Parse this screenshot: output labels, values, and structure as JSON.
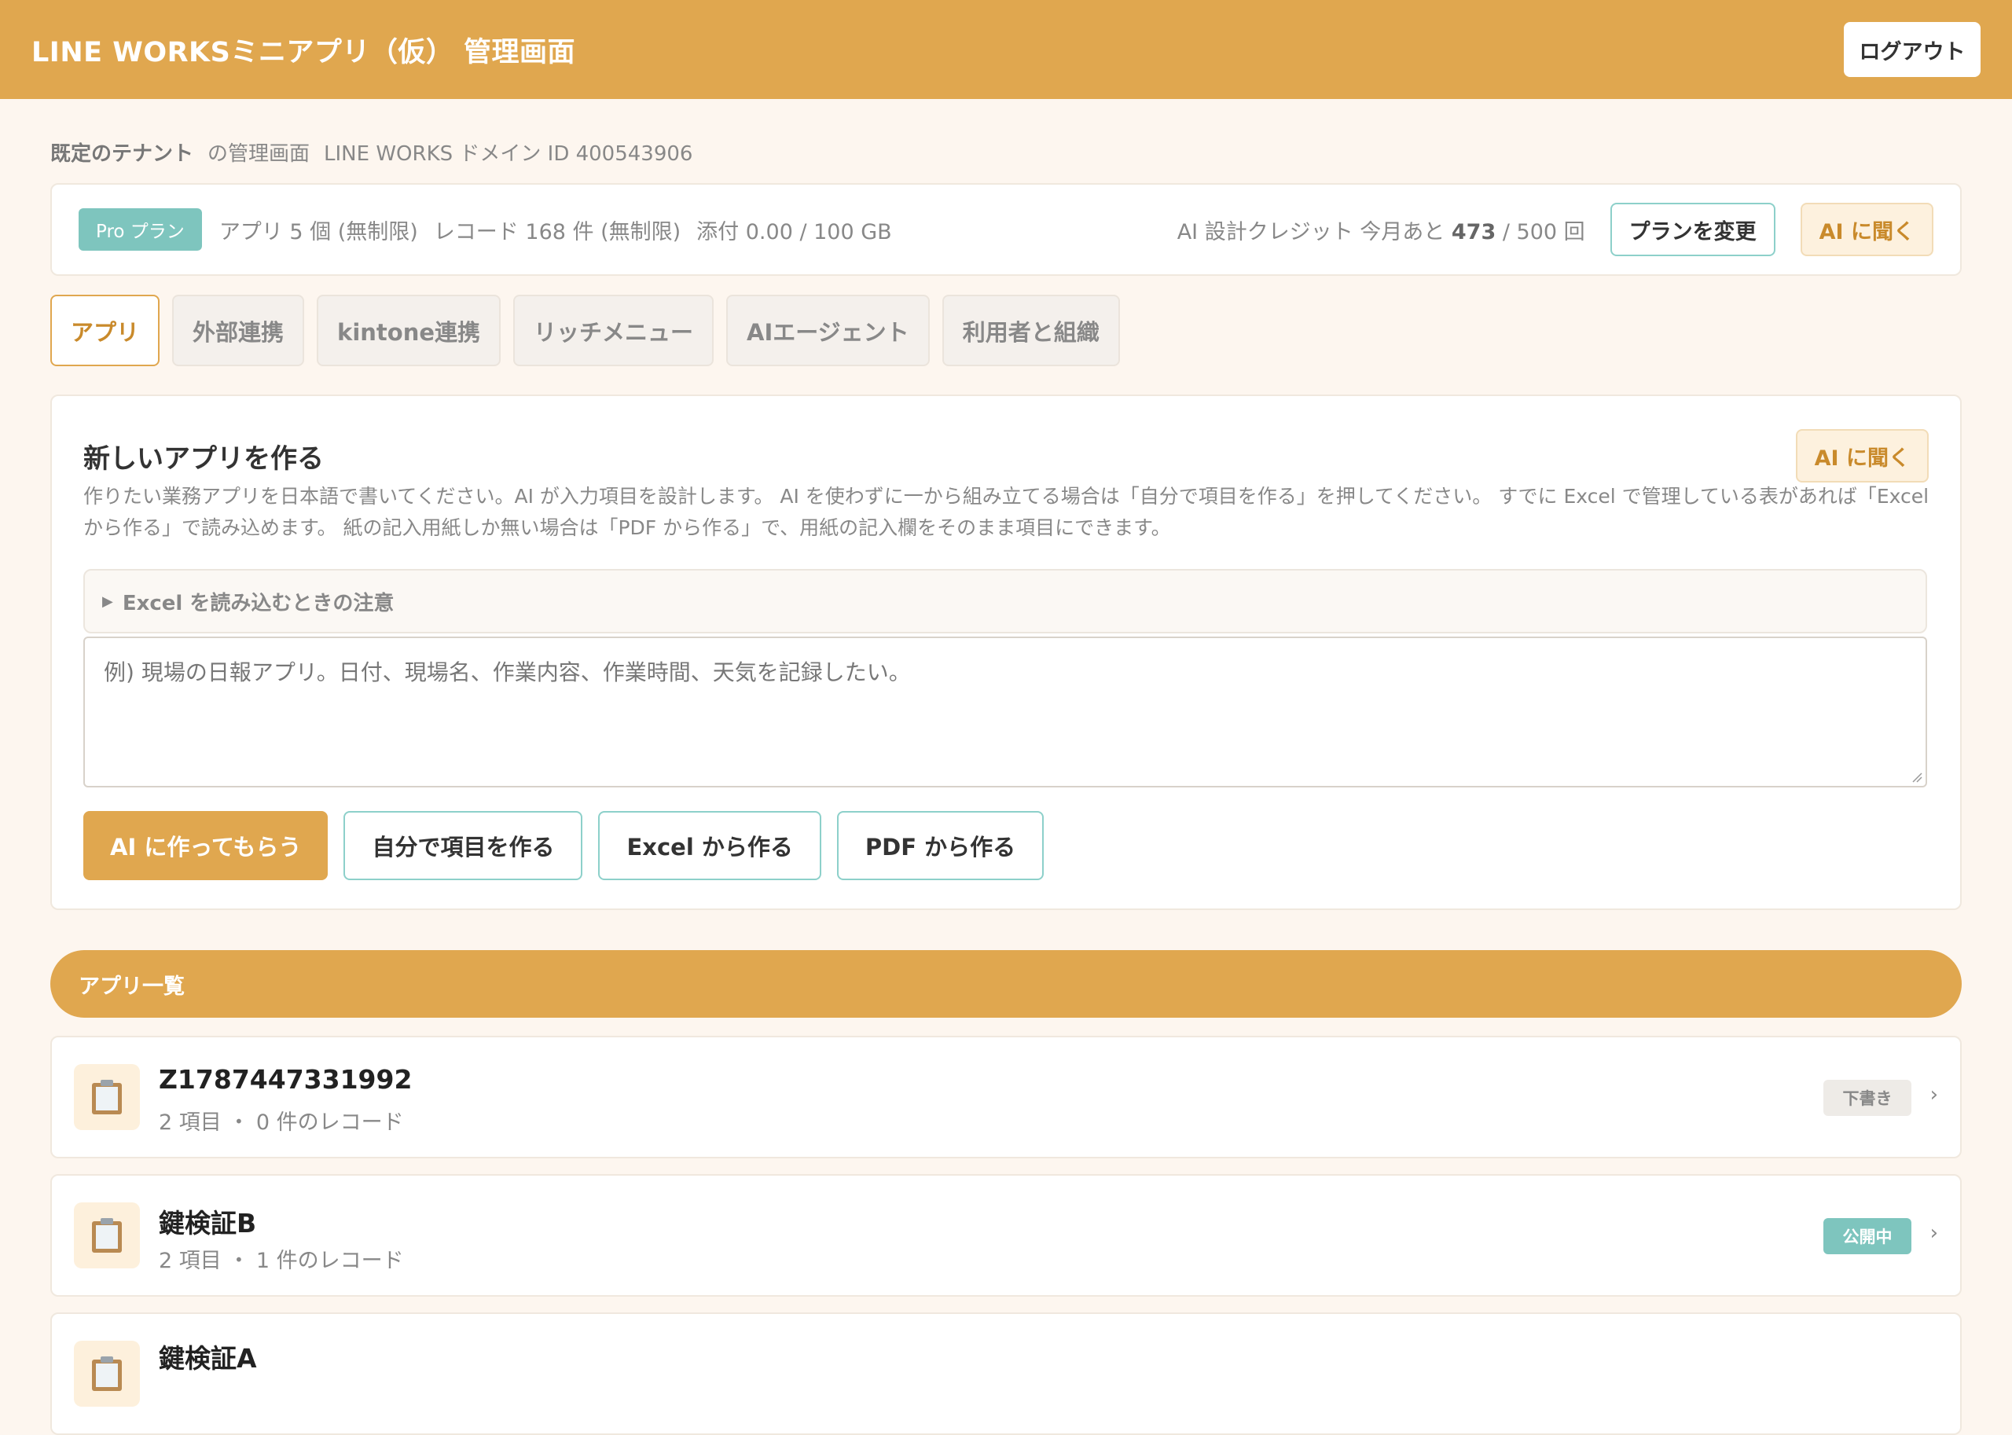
{
  "header": {
    "title": "LINE WORKSミニアプリ（仮） 管理画面",
    "logout_label": "ログアウト"
  },
  "tenant": {
    "name": "既定のテナント",
    "suffix": "の管理画面",
    "domain": "LINE WORKS ドメイン ID 400543906"
  },
  "plan": {
    "badge": "Pro プラン",
    "apps": "アプリ 5 個 (無制限)",
    "records": "レコード 168 件 (無制限)",
    "attach": "添付 0.00 / 100 GB",
    "credit_prefix": "AI 設計クレジット 今月あと",
    "credit_remaining": "473",
    "credit_suffix": "/ 500 回",
    "change_label": "プランを変更",
    "ask_ai_label": "AI に聞く"
  },
  "tabs": [
    "アプリ",
    "外部連携",
    "kintone連携",
    "リッチメニュー",
    "AIエージェント",
    "利用者と組織"
  ],
  "create": {
    "title": "新しいアプリを作る",
    "ask_ai_label": "AI に聞く",
    "description": "作りたい業務アプリを日本語で書いてください。AI が入力項目を設計します。 AI を使わずに一から組み立てる場合は「自分で項目を作る」を押してください。 すでに Excel で管理している表があれば「Excel から作る」で読み込めます。 紙の記入用紙しか無い場合は「PDF から作る」で、用紙の記入欄をそのまま項目にできます。",
    "excel_note": "Excel を読み込むときの注意",
    "placeholder": "例) 現場の日報アプリ。日付、現場名、作業内容、作業時間、天気を記録したい。",
    "buttons": {
      "ai": "AI に作ってもらう",
      "manual": "自分で項目を作る",
      "excel": "Excel から作る",
      "pdf": "PDF から作る"
    }
  },
  "list": {
    "header": "アプリ一覧",
    "items": [
      {
        "name": "Z1787447331992",
        "meta": "2 項目 ・ 0 件のレコード",
        "status": "下書き"
      },
      {
        "name": "鍵検証B",
        "meta": "2 項目 ・ 1 件のレコード",
        "status": "公開中"
      },
      {
        "name": "鍵検証A",
        "meta": "",
        "status": ""
      }
    ]
  },
  "colors": {
    "primary": "#e0a74f",
    "accent_teal": "#7ec5be",
    "background": "#fdf6ef"
  },
  "icons": {
    "app_item": "clipboard-icon",
    "row_nav": "chevron-right-icon",
    "disclosure": "triangle-right-icon"
  }
}
